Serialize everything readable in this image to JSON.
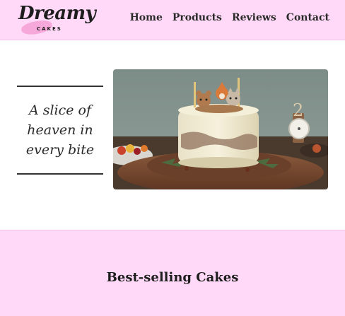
{
  "brand": {
    "name": "Dreamy",
    "sub": "CAKES"
  },
  "nav": {
    "items": [
      {
        "label": "Home"
      },
      {
        "label": "Products"
      },
      {
        "label": "Reviews"
      },
      {
        "label": "Contact"
      }
    ]
  },
  "hero": {
    "tagline_lines": [
      "A slice of",
      "heaven in",
      "every bite"
    ]
  },
  "bestsellers": {
    "title": "Best-selling Cakes"
  },
  "colors": {
    "header_bg": "#ffd9f7",
    "accent_pink": "#f7a8da",
    "text": "#222222"
  }
}
